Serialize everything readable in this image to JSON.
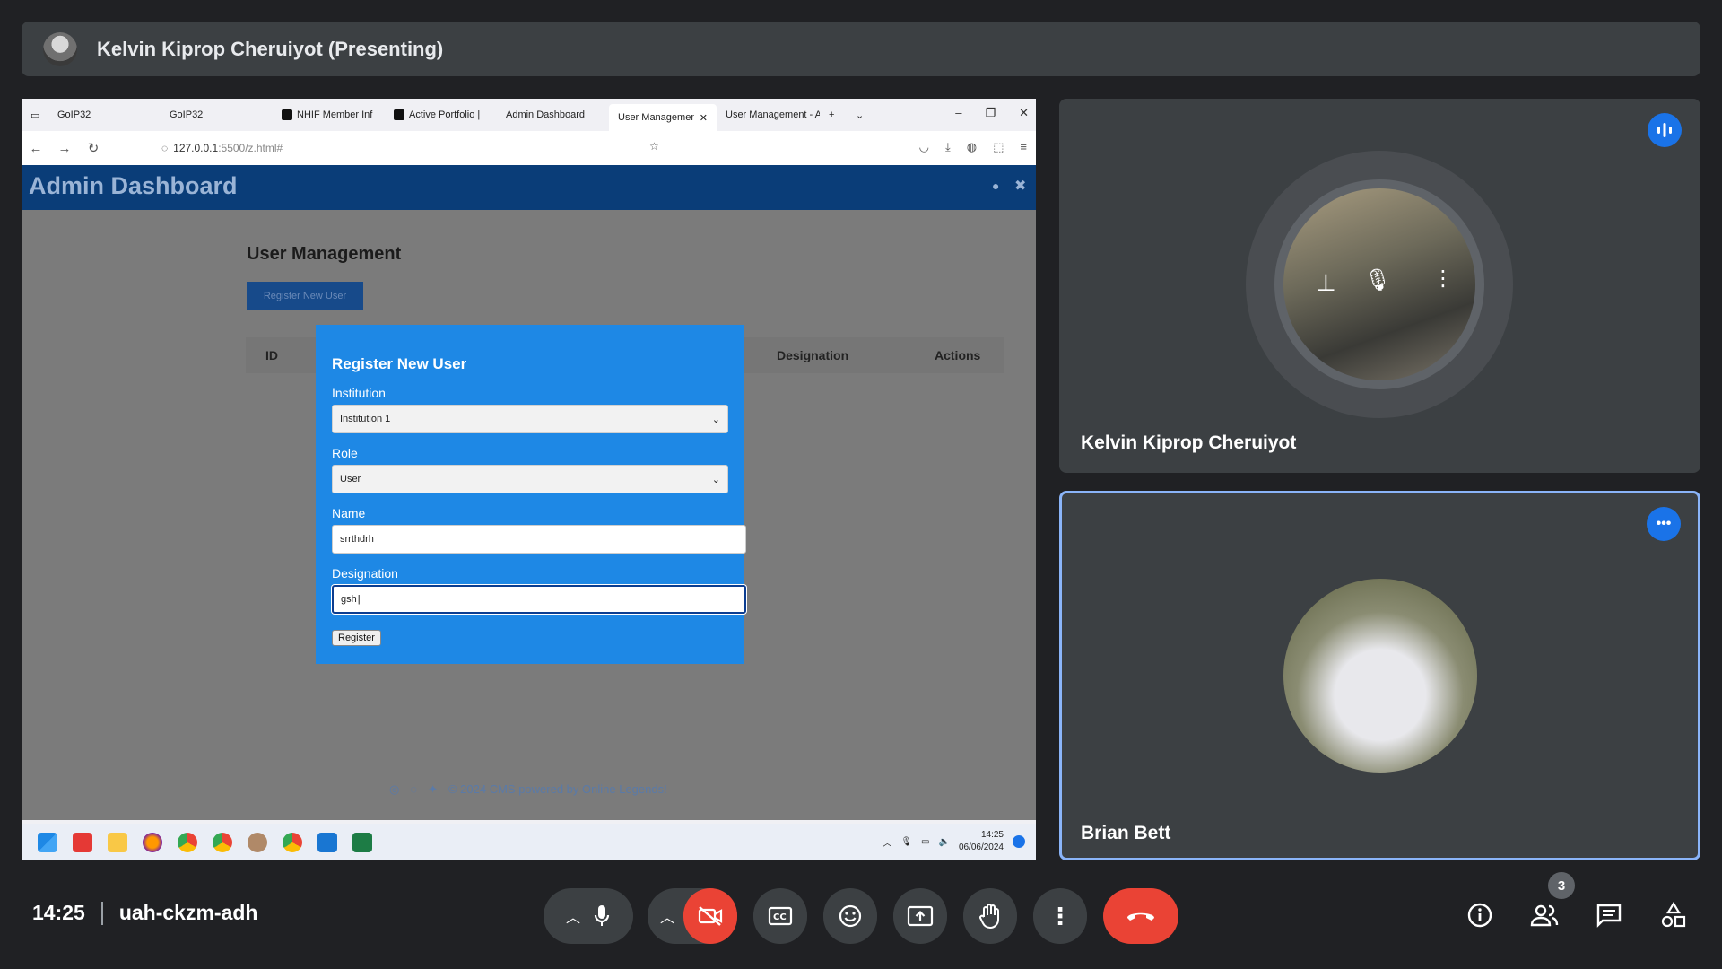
{
  "presenter_bar": {
    "label": "Kelvin Kiprop Cheruiyot (Presenting)"
  },
  "browser": {
    "tabs": [
      {
        "label": "GoIP32",
        "active": false
      },
      {
        "label": "GoIP32",
        "active": false
      },
      {
        "label": "NHIF Member Inf",
        "active": false
      },
      {
        "label": "Active Portfolio |",
        "active": false
      },
      {
        "label": "Admin Dashboard",
        "active": false
      },
      {
        "label": "User Managemen",
        "active": true
      },
      {
        "label": "User Management - A",
        "active": false
      }
    ],
    "new_tab": "+",
    "url_host": "127.0.0.1",
    "url_path": ":5500/z.html#"
  },
  "app": {
    "title": "Admin Dashboard",
    "page_title": "User Management",
    "register_button": "Register New User",
    "table_headers": [
      "ID",
      "Designation",
      "Actions"
    ],
    "footer": "© 2024 CMS powered by Online Legends!"
  },
  "modal": {
    "title": "Register New User",
    "institution_label": "Institution",
    "institution_value": "Institution 1",
    "role_label": "Role",
    "role_value": "User",
    "name_label": "Name",
    "name_value": "srrthdrh",
    "designation_label": "Designation",
    "designation_value": "gsh",
    "submit": "Register"
  },
  "taskbar": {
    "time": "14:25",
    "date": "06/06/2024"
  },
  "participants": [
    {
      "name": "Kelvin Kiprop Cheruiyot"
    },
    {
      "name": "Brian Bett"
    }
  ],
  "meeting": {
    "time": "14:25",
    "code": "uah-ckzm-adh",
    "people_count": "3"
  },
  "colors": {
    "accent": "#1a73e8",
    "end_call": "#ea4335",
    "cam_off": "#ea4335",
    "modal_bg": "#1e88e5"
  }
}
